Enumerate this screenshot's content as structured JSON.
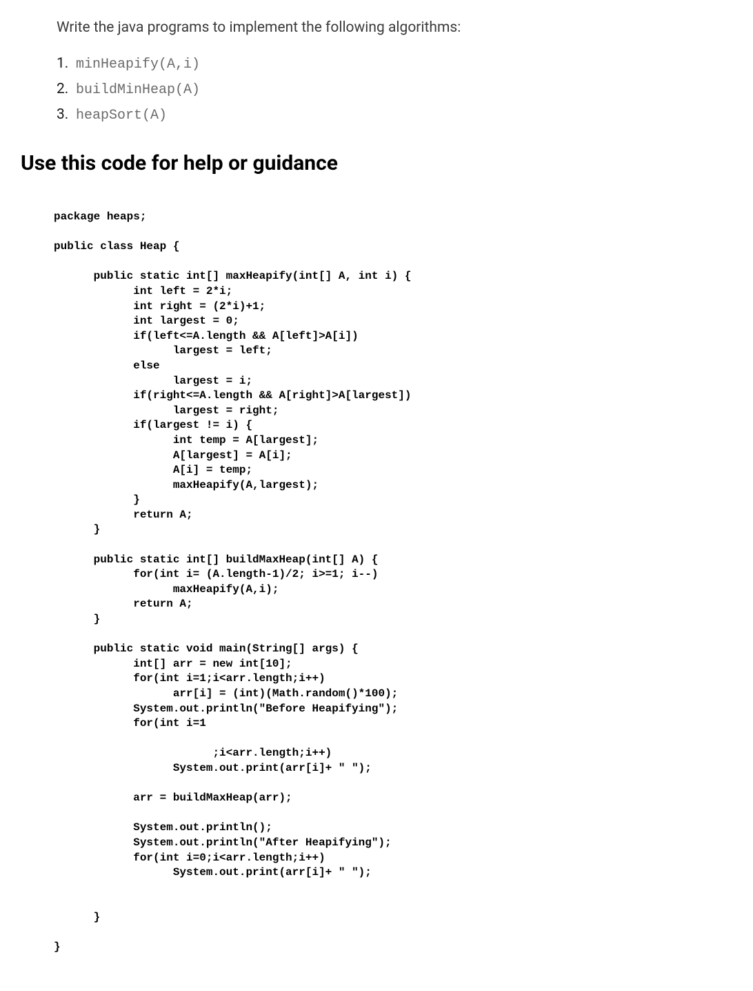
{
  "intro": "Write the java programs to implement the following algorithms:",
  "algorithms": [
    {
      "num": "1.",
      "code": "minHeapify(A,i)"
    },
    {
      "num": "2.",
      "code": "buildMinHeap(A)"
    },
    {
      "num": "3.",
      "code": "heapSort(A)"
    }
  ],
  "heading": "Use this code for help or guidance",
  "code": "package heaps;\n\npublic class Heap {\n\n      public static int[] maxHeapify(int[] A, int i) {\n            int left = 2*i;\n            int right = (2*i)+1;\n            int largest = 0;\n            if(left<=A.length && A[left]>A[i])\n                  largest = left;\n            else\n                  largest = i;\n            if(right<=A.length && A[right]>A[largest])\n                  largest = right;\n            if(largest != i) {\n                  int temp = A[largest];\n                  A[largest] = A[i];\n                  A[i] = temp;\n                  maxHeapify(A,largest);\n            }\n            return A;\n      }\n\n      public static int[] buildMaxHeap(int[] A) {\n            for(int i= (A.length-1)/2; i>=1; i--)\n                  maxHeapify(A,i);\n            return A;\n      }\n\n      public static void main(String[] args) {\n            int[] arr = new int[10];\n            for(int i=1;i<arr.length;i++)\n                  arr[i] = (int)(Math.random()*100);\n            System.out.println(\"Before Heapifying\");\n            for(int i=1\n\n                        ;i<arr.length;i++)\n                  System.out.print(arr[i]+ \" \");\n\n            arr = buildMaxHeap(arr);\n\n            System.out.println();\n            System.out.println(\"After Heapifying\");\n            for(int i=0;i<arr.length;i++)\n                  System.out.print(arr[i]+ \" \");\n\n\n      }\n\n}"
}
